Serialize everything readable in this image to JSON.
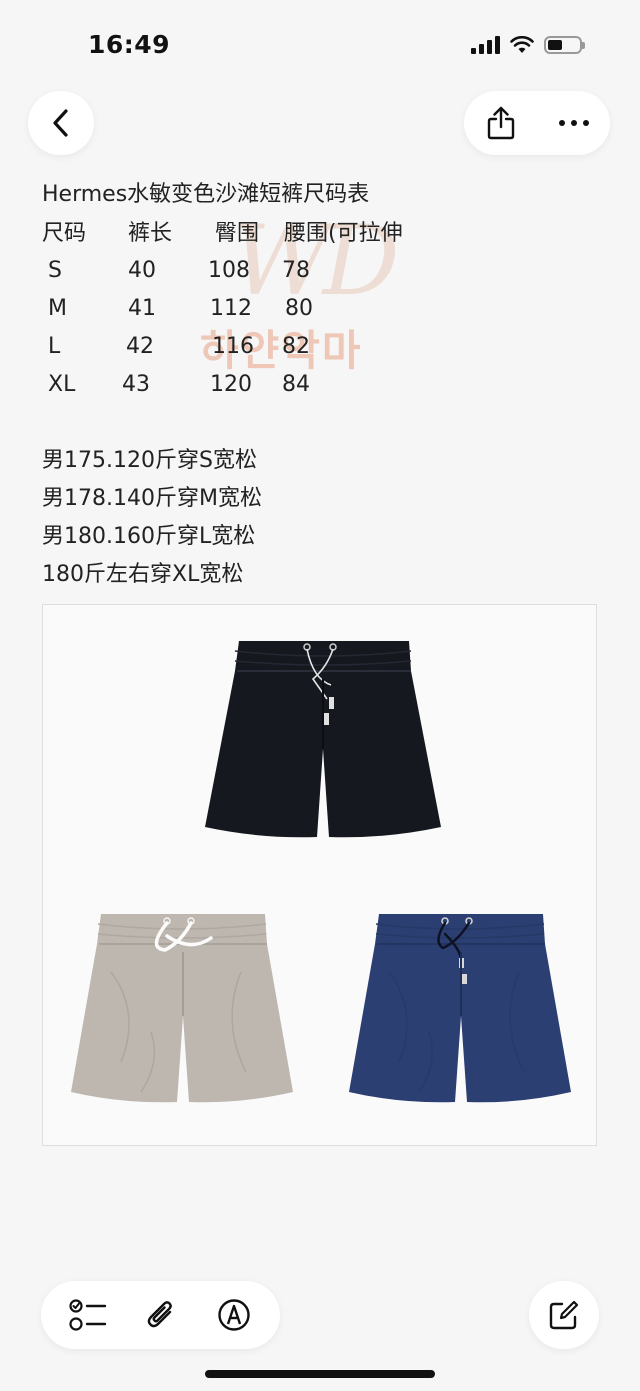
{
  "status_bar": {
    "time": "16:49"
  },
  "note": {
    "title": "Hermes水敏变色沙滩短裤尺码表",
    "size_table": {
      "headers": [
        "尺码",
        "裤长",
        "臀围",
        "腰围(可拉伸"
      ],
      "rows": [
        [
          "S",
          "40",
          "108",
          "78"
        ],
        [
          "M",
          "41",
          "112",
          "80"
        ],
        [
          "L",
          "42",
          "116",
          "82"
        ],
        [
          "XL",
          "43",
          "120",
          "84"
        ]
      ]
    },
    "recommendations": [
      "男175.120斤穿S宽松",
      "男178.140斤穿M宽松",
      "男180.160斤穿L宽松",
      "180斤左右穿XL宽松"
    ],
    "watermark": {
      "logo": "WD",
      "text": "하얀악마"
    }
  },
  "product_image": {
    "items": [
      {
        "color": "black",
        "hex": "#15181f"
      },
      {
        "color": "beige",
        "hex": "#bdb7b0"
      },
      {
        "color": "navy",
        "hex": "#2c3f73"
      }
    ]
  },
  "icons": {
    "back": "chevron-left-icon",
    "share": "share-icon",
    "more": "more-icon",
    "checklist": "checklist-icon",
    "attach": "paperclip-icon",
    "markup": "pen-circle-icon",
    "compose": "compose-icon"
  }
}
